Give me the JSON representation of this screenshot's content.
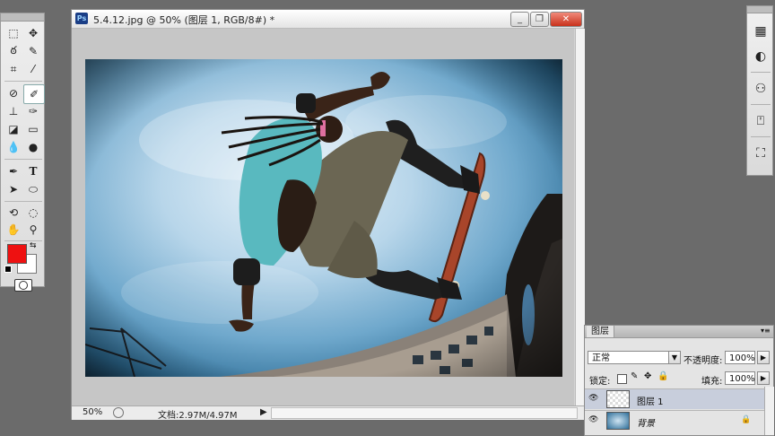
{
  "document": {
    "title": "5.4.12.jpg @ 50% (图层 1, RGB/8#) *",
    "ps_badge": "Ps",
    "minimize_symbol": "_",
    "restore_symbol": "❐",
    "close_symbol": "✕",
    "zoom": "50%",
    "doc_size": "文档:2.97M/4.97M",
    "status_arrow": "▶"
  },
  "layers_panel": {
    "tab": "图层",
    "blend_mode": "正常",
    "opacity_label": "不透明度:",
    "opacity_value": "100%",
    "lock_label": "锁定:",
    "fill_label": "填充:",
    "fill_value": "100%",
    "layers": [
      {
        "name": "图层 1",
        "selected": true
      },
      {
        "name": "背景",
        "selected": false
      }
    ]
  },
  "colors": {
    "foreground": "#ee1111",
    "background": "#ffffff",
    "selected_layer_row": "#c8cedc"
  },
  "toolbox_icons": [
    "marquee-icon",
    "move-icon",
    "lasso-icon",
    "quick-select-icon",
    "crop-icon",
    "eyedropper-icon",
    "healing-icon",
    "brush-icon",
    "stamp-icon",
    "history-brush-icon",
    "eraser-icon",
    "gradient-icon",
    "blur-icon",
    "dodge-icon",
    "pen-icon",
    "type-icon",
    "path-select-icon",
    "shape-icon",
    "3d-rotate-icon",
    "3d-orbit-icon",
    "hand-icon",
    "zoom-icon",
    "quick-mask-icon"
  ],
  "dock_icons": [
    "grid-icon",
    "contrast-icon",
    "spheres-icon",
    "adjust-icon",
    "transform-icon"
  ]
}
